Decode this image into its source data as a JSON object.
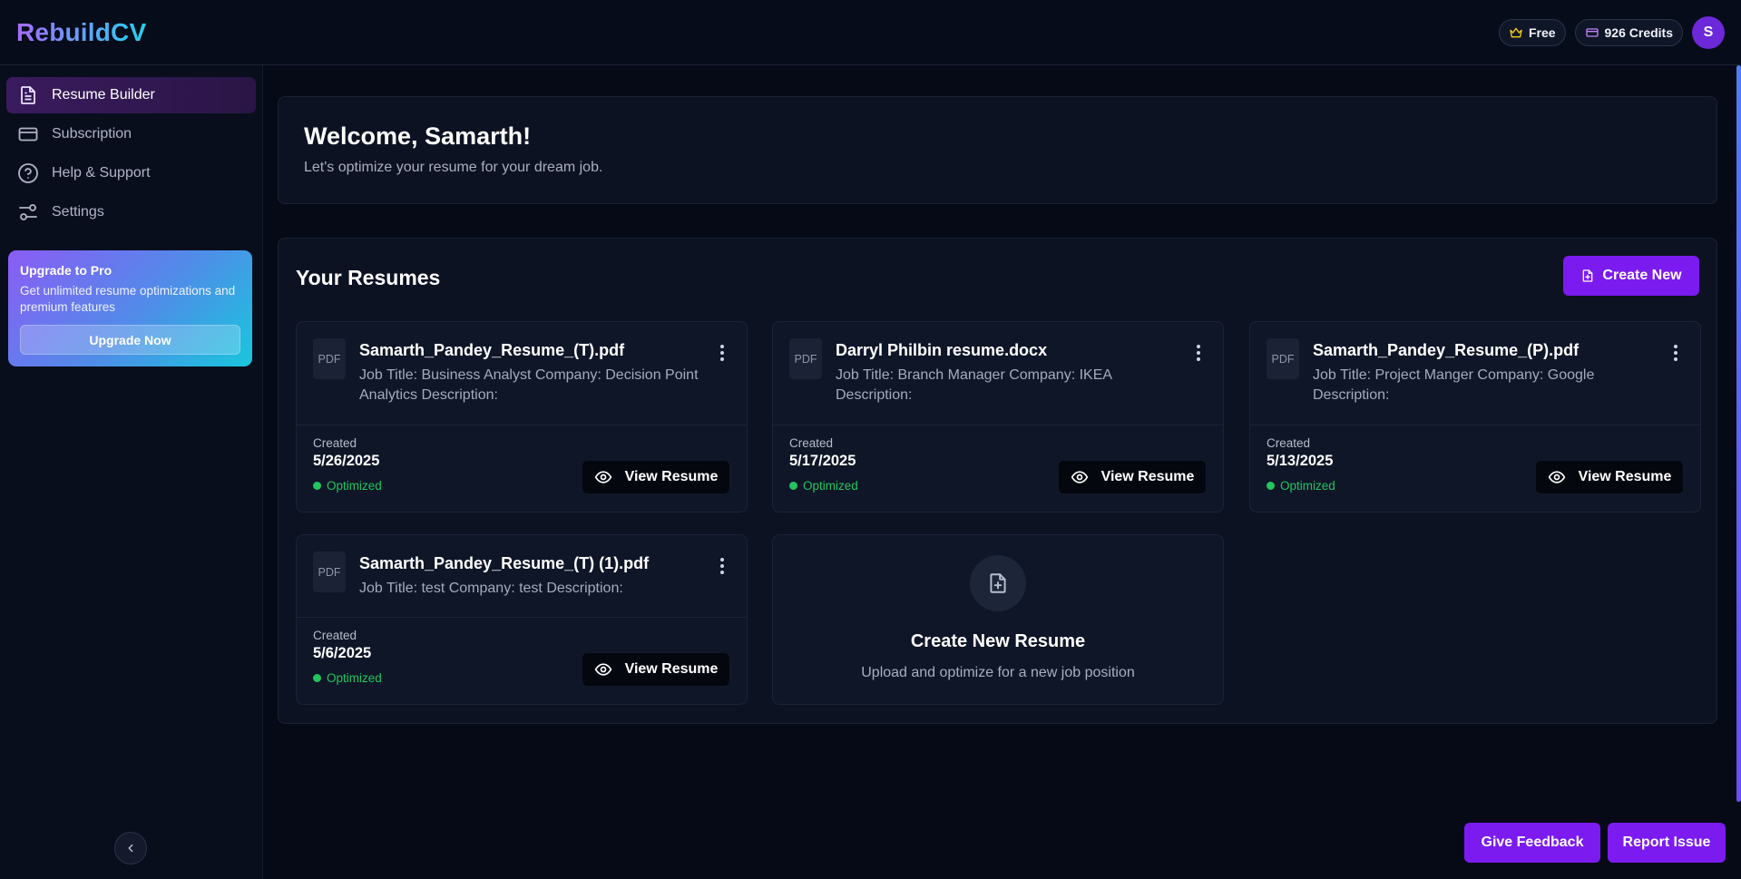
{
  "app": {
    "logo": "RebuildCV"
  },
  "header": {
    "plan_label": "Free",
    "credits_label": "926 Credits",
    "avatar_initial": "S"
  },
  "sidebar": {
    "items": [
      {
        "label": "Resume Builder",
        "icon": "document-icon",
        "active": true
      },
      {
        "label": "Subscription",
        "icon": "credit-card-icon",
        "active": false
      },
      {
        "label": "Help & Support",
        "icon": "help-circle-icon",
        "active": false
      },
      {
        "label": "Settings",
        "icon": "sliders-icon",
        "active": false
      }
    ],
    "promo": {
      "title": "Upgrade to Pro",
      "description": "Get unlimited resume optimizations and premium features",
      "button_label": "Upgrade Now"
    }
  },
  "welcome": {
    "title": "Welcome, Samarth!",
    "subtitle": "Let's optimize your resume for your dream job."
  },
  "resumes": {
    "title": "Your Resumes",
    "create_button_label": "Create New",
    "cards": [
      {
        "file_type": "PDF",
        "name": "Samarth_Pandey_Resume_(T).pdf",
        "description": "Job Title: Business Analyst Company: Decision Point Analytics Description:",
        "created_label": "Created",
        "created_date": "5/26/2025",
        "status": "Optimized",
        "view_label": "View Resume"
      },
      {
        "file_type": "PDF",
        "name": "Darryl Philbin resume.docx",
        "description": "Job Title: Branch Manager Company: IKEA Description:",
        "created_label": "Created",
        "created_date": "5/17/2025",
        "status": "Optimized",
        "view_label": "View Resume"
      },
      {
        "file_type": "PDF",
        "name": "Samarth_Pandey_Resume_(P).pdf",
        "description": "Job Title: Project Manger Company: Google Description:",
        "created_label": "Created",
        "created_date": "5/13/2025",
        "status": "Optimized",
        "view_label": "View Resume"
      },
      {
        "file_type": "PDF",
        "name": "Samarth_Pandey_Resume_(T) (1).pdf",
        "description": "Job Title: test Company: test Description:",
        "created_label": "Created",
        "created_date": "5/6/2025",
        "status": "Optimized",
        "view_label": "View Resume"
      }
    ],
    "create_card": {
      "title": "Create New Resume",
      "subtitle": "Upload and optimize for a new job position"
    }
  },
  "footer_actions": {
    "feedback_label": "Give Feedback",
    "report_label": "Report Issue"
  },
  "colors": {
    "accent": "#7c1bf0",
    "success": "#22c55e",
    "background": "#060a17"
  }
}
